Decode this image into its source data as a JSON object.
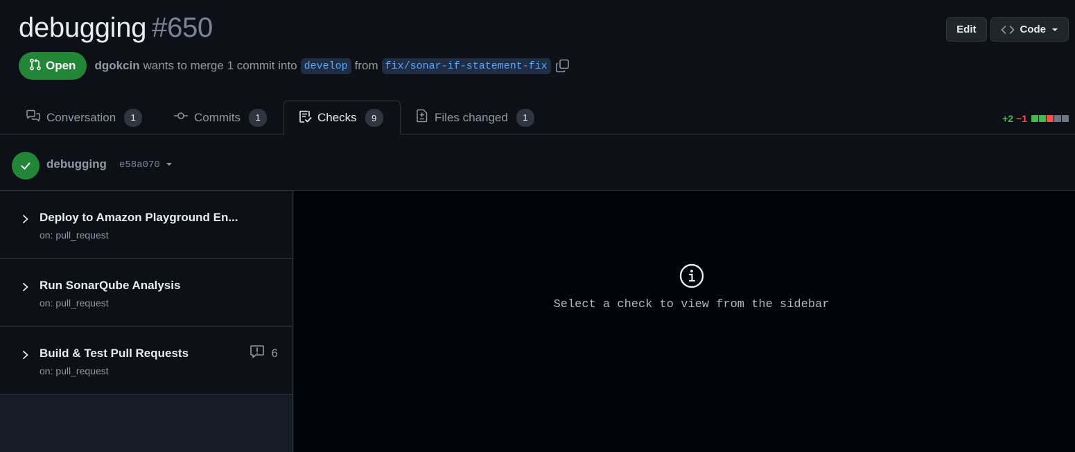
{
  "pr": {
    "title": "debugging",
    "number": "#650",
    "state": "Open",
    "author": "dgokcin",
    "merge_text": "wants to merge 1 commit into",
    "base_branch": "develop",
    "from_text": "from",
    "head_branch": "fix/sonar-if-statement-fix"
  },
  "actions": {
    "edit": "Edit",
    "code": "Code"
  },
  "tabs": [
    {
      "label": "Conversation",
      "count": "1",
      "icon": "comment-discussion-icon"
    },
    {
      "label": "Commits",
      "count": "1",
      "icon": "git-commit-icon"
    },
    {
      "label": "Checks",
      "count": "9",
      "icon": "checklist-icon",
      "active": true
    },
    {
      "label": "Files changed",
      "count": "1",
      "icon": "file-diff-icon"
    }
  ],
  "diffstat": {
    "additions": "+2",
    "deletions": "−1"
  },
  "colors": {
    "success": "#238636",
    "add": "#3fb950",
    "del": "#f85149",
    "accent": "#58a6ff"
  },
  "suite": {
    "name": "debugging",
    "sha": "e58a070"
  },
  "checks": [
    {
      "name": "Deploy to Amazon Playground En...",
      "event": "on: pull_request"
    },
    {
      "name": "Run SonarQube Analysis",
      "event": "on: pull_request"
    },
    {
      "name": "Build & Test Pull Requests",
      "event": "on: pull_request",
      "annotations": "6"
    }
  ],
  "main": {
    "empty_message": "Select a check to view from the sidebar"
  }
}
